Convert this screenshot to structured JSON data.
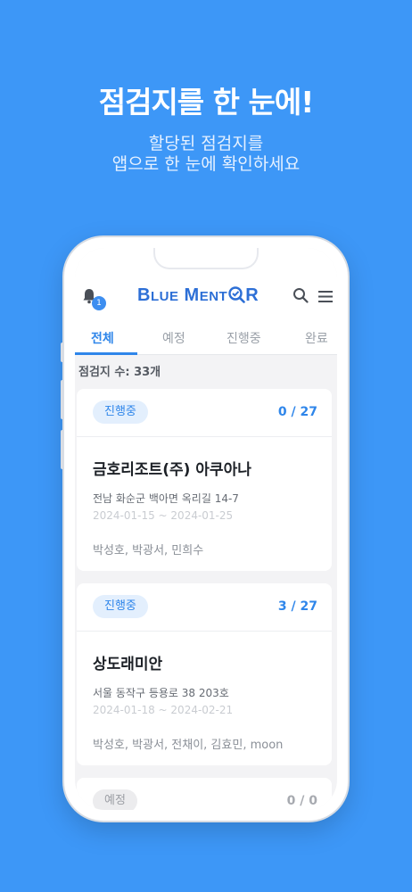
{
  "promo": {
    "headline": "점검지를 한 눈에!",
    "sub_line1": "할당된 점검지를",
    "sub_line2": "앱으로 한 눈에 확인하세요"
  },
  "header": {
    "logo_big1": "B",
    "logo_small1": "LUE",
    "logo_big2": "M",
    "logo_small2": "ENT",
    "logo_end": "R",
    "notification_count": "1",
    "icons": [
      "bell-icon",
      "search-icon",
      "menu-icon"
    ]
  },
  "tabs": [
    {
      "label": "전체",
      "active": true
    },
    {
      "label": "예정",
      "active": false
    },
    {
      "label": "진행중",
      "active": false
    },
    {
      "label": "완료",
      "active": false
    }
  ],
  "list": {
    "count_text": "점검지 수: 33개",
    "cards": [
      {
        "status": "진행중",
        "progress": "0 / 27",
        "name": "금호리조트(주) 아쿠아나",
        "address": "전남 화순군 백아면 옥리길 14-7",
        "period": "2024-01-15 ~ 2024-01-25",
        "members": "박성호, 박광서, 민희수"
      },
      {
        "status": "진행중",
        "progress": "3 / 27",
        "name": "상도래미안",
        "address": "서울 동작구 등용로 38 203호",
        "period": "2024-01-18 ~ 2024-02-21",
        "members": "박성호, 박광서, 전채이, 김효민, moon"
      },
      {
        "status": "예정",
        "progress": "0 / 0"
      }
    ]
  },
  "colors": {
    "background": "#3d97f7",
    "accent": "#2f86ea",
    "logo": "#2d6fd6"
  }
}
